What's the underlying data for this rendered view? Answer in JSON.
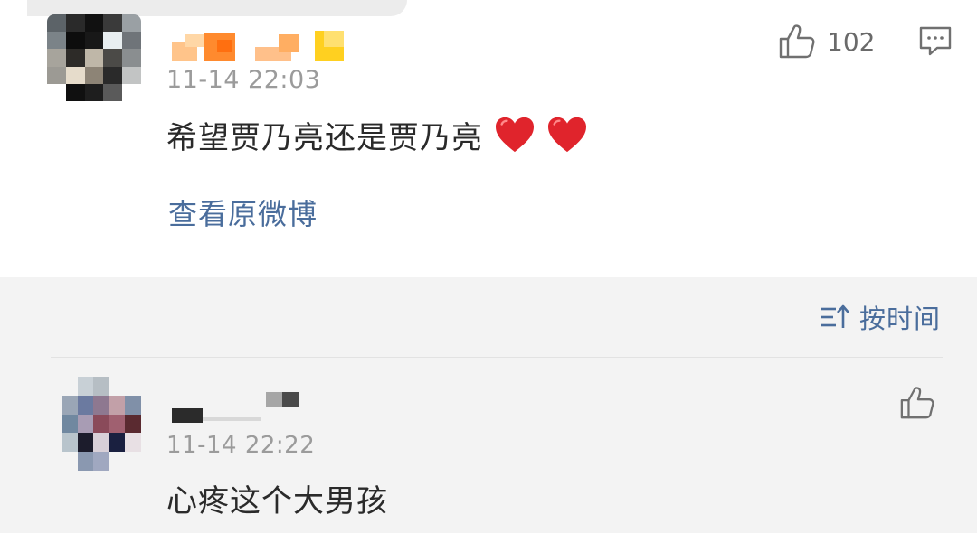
{
  "comments": [
    {
      "timestamp": "11-14 22:03",
      "text": "希望贾乃亮还是贾乃亮",
      "emoji_icons": [
        "red-heart-icon",
        "red-heart-icon"
      ],
      "like_count": "102",
      "link": "查看原微博"
    },
    {
      "timestamp": "11-14 22:22",
      "text": "心疼这个大男孩"
    }
  ],
  "sort": {
    "label": "按时间",
    "icon": "sort-ascending-icon"
  },
  "colors": {
    "link_blue": "#4a6d9c",
    "heart_red": "#e0242c",
    "timestamp_gray": "#9b9b9b",
    "text_dark": "#2a2a2a",
    "section_gray": "#f3f3f3"
  }
}
